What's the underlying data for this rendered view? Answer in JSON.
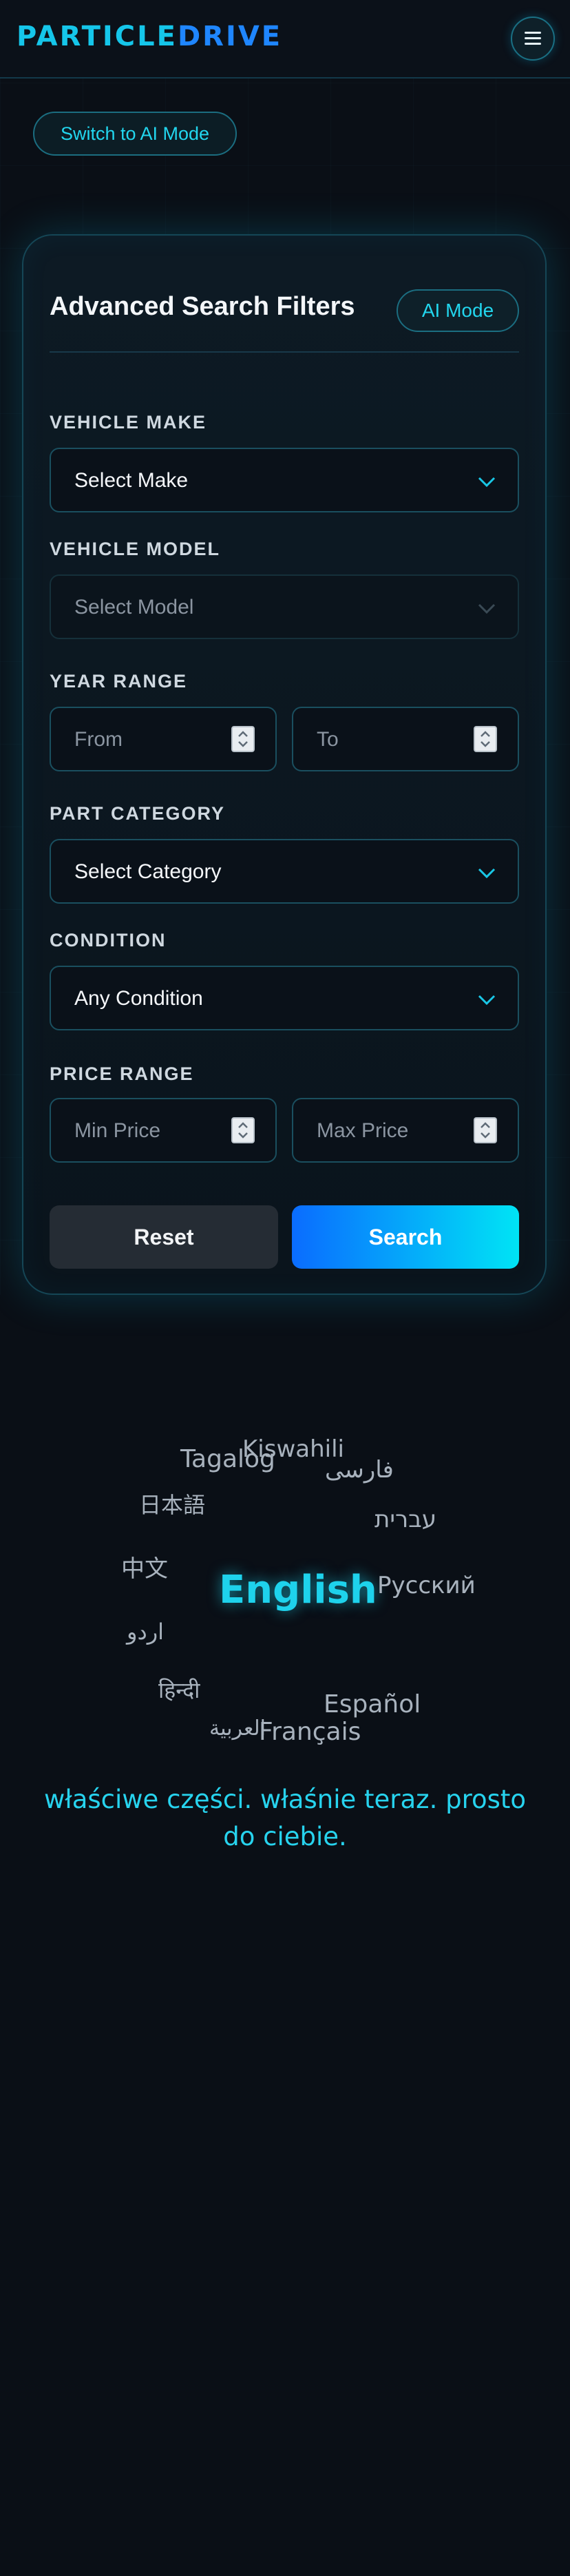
{
  "header": {
    "logo_part1": "PARTICLE",
    "logo_part2": "DRIVE",
    "menu_icon": "hamburger-icon"
  },
  "switch_mode_label": "Switch to AI Mode",
  "filters": {
    "title": "Advanced Search Filters",
    "ai_mode_label": "AI Mode",
    "make": {
      "label": "VEHICLE MAKE",
      "value": "Select Make"
    },
    "model": {
      "label": "VEHICLE MODEL",
      "value": "Select Model"
    },
    "year": {
      "label": "YEAR RANGE",
      "from_placeholder": "From",
      "to_placeholder": "To"
    },
    "category": {
      "label": "PART CATEGORY",
      "value": "Select Category"
    },
    "condition": {
      "label": "CONDITION",
      "value": "Any Condition"
    },
    "price": {
      "label": "PRICE RANGE",
      "min_placeholder": "Min Price",
      "max_placeholder": "Max Price"
    },
    "reset_label": "Reset",
    "search_label": "Search"
  },
  "languages": {
    "kiswahili": "Kiswahili",
    "tagalog": "Tagalog",
    "farsi": "فارسی",
    "japanese": "日本語",
    "hebrew": "עברית",
    "chinese": "中文",
    "english": "English",
    "russian": "Русский",
    "urdu": "اردو",
    "hindi": "हिन्दी",
    "spanish": "Español",
    "arabic": "العربية",
    "french": "Français"
  },
  "tagline": "właściwe części. właśnie teraz. prosto do ciebie.",
  "colors": {
    "accent_cyan": "#15c6ea",
    "accent_blue": "#1f86ff",
    "background": "#0a0f16"
  }
}
